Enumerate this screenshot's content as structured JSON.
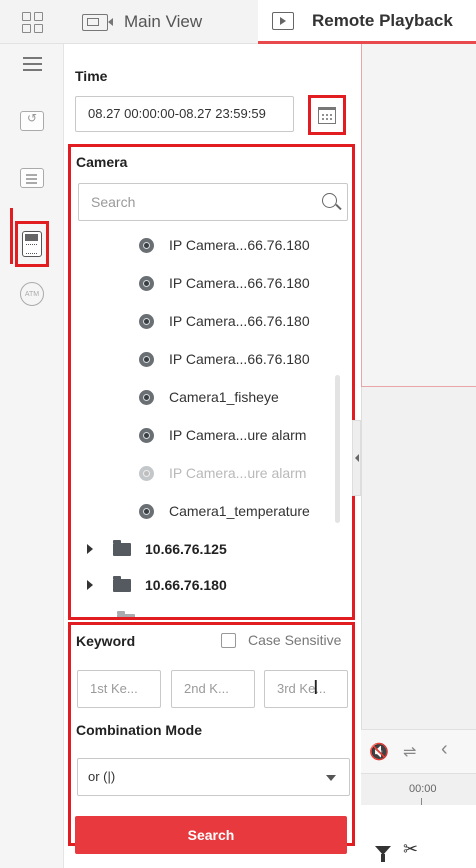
{
  "tabs": {
    "main_view": "Main View",
    "remote_playback": "Remote Playback"
  },
  "sidebar": {
    "items": [
      {
        "icon": "menu-icon"
      },
      {
        "icon": "recording-icon"
      },
      {
        "icon": "list-icon"
      },
      {
        "icon": "dvr-icon",
        "selected": true
      },
      {
        "icon": "atm-icon",
        "text": "ATM"
      }
    ]
  },
  "time": {
    "label": "Time",
    "range": "08.27 00:00:00-08.27 23:59:59"
  },
  "camera": {
    "label": "Camera",
    "search_placeholder": "Search",
    "items": [
      {
        "name": "IP Camera...66.76.180",
        "online": true
      },
      {
        "name": "IP Camera...66.76.180",
        "online": true
      },
      {
        "name": "IP Camera...66.76.180",
        "online": true
      },
      {
        "name": "IP Camera...66.76.180",
        "online": true
      },
      {
        "name": "Camera1_fisheye",
        "online": true
      },
      {
        "name": "IP Camera...ure alarm",
        "online": true
      },
      {
        "name": "IP Camera...ure alarm",
        "online": false
      },
      {
        "name": "Camera1_temperature",
        "online": true
      }
    ],
    "groups": [
      {
        "name": "10.66.76.125"
      },
      {
        "name": "10.66.76.180"
      }
    ]
  },
  "keyword": {
    "label": "Keyword",
    "case_sensitive_label": "Case Sensitive",
    "case_sensitive_checked": false,
    "placeholders": [
      "1st Ke...",
      "2nd K...",
      "3rd Ke..."
    ],
    "combination_label": "Combination Mode",
    "combination_value": "or (|)"
  },
  "search_button": "Search",
  "timeline": {
    "time_label": "00:00"
  },
  "colors": {
    "accent_red": "#e8393e",
    "highlight_border": "#e11d22"
  }
}
